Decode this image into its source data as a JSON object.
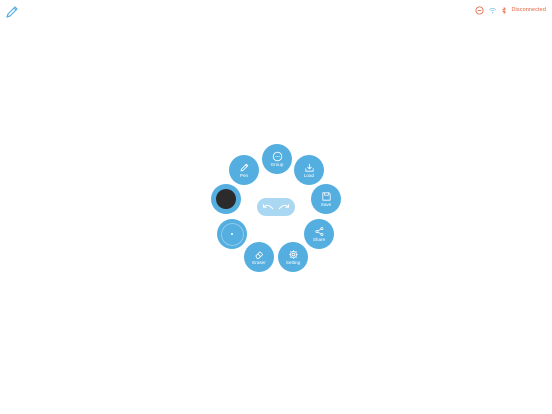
{
  "status": {
    "connection_text": "Disconnected",
    "status_color": "#e0623a"
  },
  "menu": {
    "pen_label": "Pen",
    "group_label": "Group",
    "load_label": "Load",
    "save_label": "Save",
    "share_label": "Share",
    "setting_label": "Setting",
    "eraser_label": "Eraser"
  },
  "colors": {
    "accent": "#55aee0",
    "selected_ink": "#2b2b2b",
    "undo_redo_bg": "#aad7f1"
  },
  "icons": {
    "top_left": "pen-icon",
    "status": [
      "battery-status-icon",
      "wifi-icon",
      "bluetooth-icon"
    ]
  }
}
